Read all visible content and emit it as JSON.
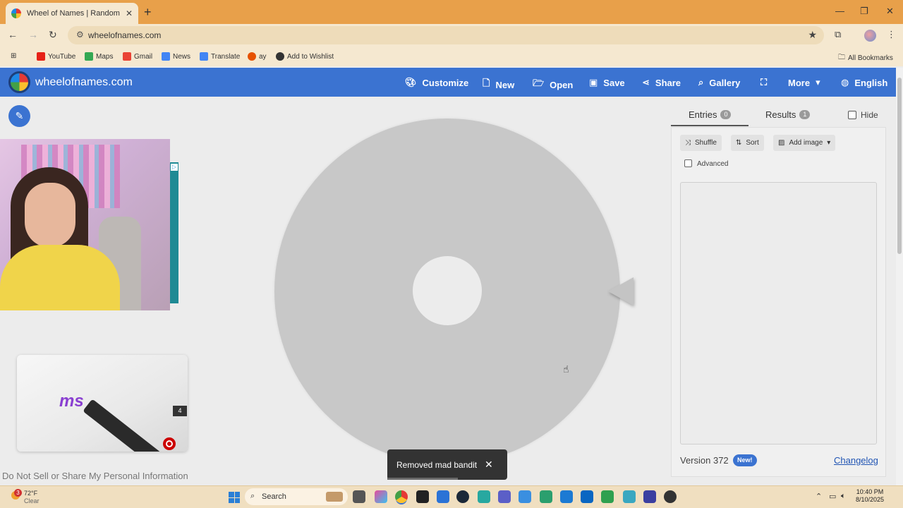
{
  "browser": {
    "tab_title": "Wheel of Names | Random nam",
    "url": "wheelofnames.com",
    "bookmarks": [
      {
        "label": "YouTube",
        "color": "#e62117"
      },
      {
        "label": "Maps",
        "color": "#34a853"
      },
      {
        "label": "Gmail",
        "color": "#ea4335"
      },
      {
        "label": "News",
        "color": "#4285f4"
      },
      {
        "label": "Translate",
        "color": "#4285f4"
      },
      {
        "label": "ay",
        "color": "#e65100"
      },
      {
        "label": "Add to Wishlist",
        "color": "#333333"
      }
    ],
    "all_bookmarks": "All Bookmarks"
  },
  "app": {
    "site_name": "wheelofnames.com",
    "nav": [
      {
        "label": "Customize",
        "icon": "palette-icon"
      },
      {
        "label": "New",
        "icon": "file-icon"
      },
      {
        "label": "Open",
        "icon": "folder-icon"
      },
      {
        "label": "Save",
        "icon": "save-icon"
      },
      {
        "label": "Share",
        "icon": "share-icon"
      },
      {
        "label": "Gallery",
        "icon": "search-icon"
      },
      {
        "label": "More",
        "icon": "caret-down-icon"
      },
      {
        "label": "English",
        "icon": "globe-icon"
      }
    ],
    "accent": "#3b73d1"
  },
  "ads": {
    "do_not_sell": "Do Not Sell or Share My Personal Information",
    "ad2_text": "ms",
    "ad2_count": "4"
  },
  "toast": {
    "message": "Removed mad bandit",
    "close": "✕"
  },
  "panel": {
    "tabs": [
      {
        "label": "Entries",
        "count": "0",
        "active": true
      },
      {
        "label": "Results",
        "count": "1",
        "active": false
      }
    ],
    "hide_label": "Hide",
    "buttons": {
      "shuffle": "Shuffle",
      "sort": "Sort",
      "add_image": "Add image"
    },
    "advanced_label": "Advanced",
    "version": "Version 372",
    "new_badge": "New!",
    "changelog": "Changelog"
  },
  "taskbar": {
    "temp": "72°F",
    "condition": "Clear",
    "weather_badge": "3",
    "search_placeholder": "Search",
    "time": "10:40 PM",
    "date": "8/10/2025"
  }
}
